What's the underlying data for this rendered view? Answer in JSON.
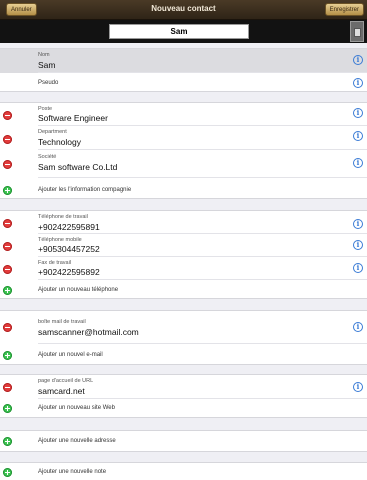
{
  "nav": {
    "title": "Nouveau contact",
    "cancel_label": "Annuler",
    "save_label": "Enregistrer"
  },
  "header": {
    "display_name": "Sam"
  },
  "name_section": {
    "name_label": "Nom",
    "name_value": "Sam",
    "nickname_label": "Pseudo"
  },
  "company_section": {
    "position_label": "Poste",
    "position_value": "Software Engineer",
    "department_label": "Department",
    "department_value": "Technology",
    "company_label": "Société",
    "company_value": "Sam software Co.Ltd",
    "add_company_label": "Ajouter les l'information compagnie"
  },
  "phone_section": {
    "phones": [
      {
        "label": "Téléphone de travail",
        "value": "+902422595891"
      },
      {
        "label": "Téléphone mobile",
        "value": "+905304457252"
      },
      {
        "label": "Fax de travail",
        "value": "+902422595892"
      }
    ],
    "add_phone_label": "Ajouter un nouveau téléphone"
  },
  "email_section": {
    "email_label": "boîte mail de travail",
    "email_value": "samscanner@hotmail.com",
    "add_email_label": "Ajouter un nouvel e-mail"
  },
  "url_section": {
    "url_label": "page d'accueil de URL",
    "url_value": "samcard.net",
    "add_url_label": "Ajouter un nouveau site Web"
  },
  "address_section": {
    "add_address_label": "Ajouter une nouvelle adresse"
  },
  "note_section": {
    "add_note_label": "Ajouter une nouvelle note"
  },
  "colors": {
    "nav_bg": "#3c2f1f",
    "accent_blue": "#3a7bd5",
    "delete_red": "#e23b3b",
    "add_green": "#3cc551"
  },
  "icons": {
    "info": "info-icon",
    "delete": "minus-circle-icon",
    "add": "plus-circle-icon"
  },
  "icon_glyphs": {
    "info": "i"
  }
}
